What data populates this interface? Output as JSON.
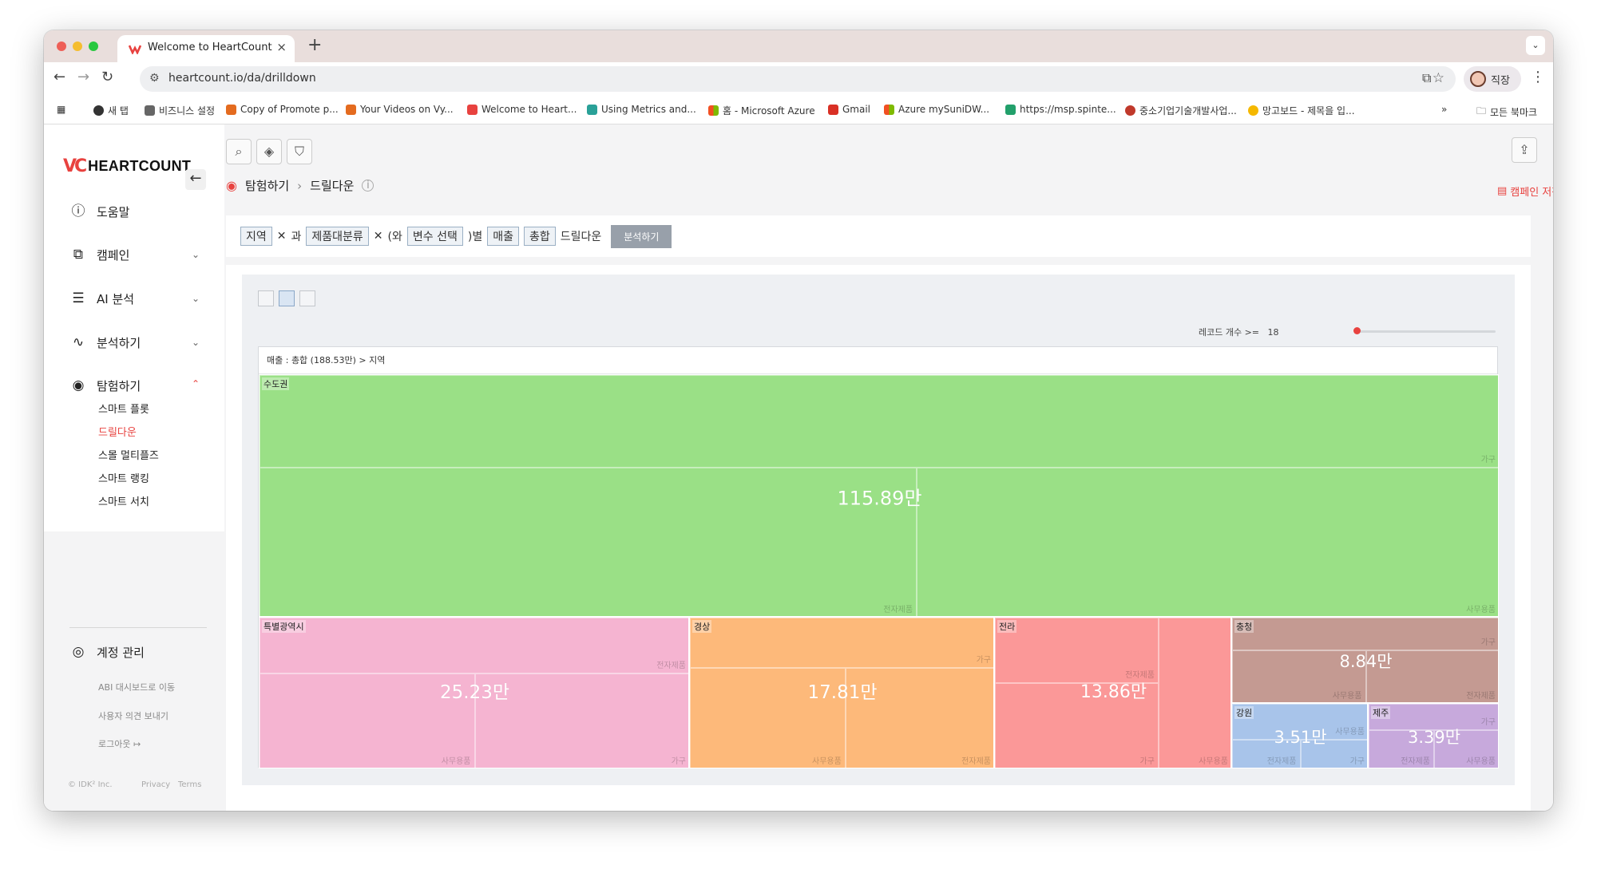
{
  "browser": {
    "tab_title": "Welcome to HeartCount",
    "url": "heartcount.io/da/drilldown",
    "profile_name": "직장",
    "bookmarks": [
      {
        "label": "새 탭",
        "color": "#333333"
      },
      {
        "label": "비즈니스 설정",
        "color": "#555555"
      },
      {
        "label": "Copy of Promote p...",
        "color": "#e46b1f"
      },
      {
        "label": "Your Videos on Vy...",
        "color": "#e46b1f"
      },
      {
        "label": "Welcome to Heart...",
        "color": "#e8423f"
      },
      {
        "label": "Using Metrics and...",
        "color": "#2aa198"
      },
      {
        "label": "홈 - Microsoft Azure",
        "color": "#f25022"
      },
      {
        "label": "Gmail",
        "color": "#d93025"
      },
      {
        "label": "Azure mySuniDW...",
        "color": "#f25022"
      },
      {
        "label": "https://msp.spinte...",
        "color": "#22a06b"
      },
      {
        "label": "중소기업기술개발사업...",
        "color": "#c0392b"
      },
      {
        "label": "망고보드 - 제목을 입...",
        "color": "#f5b800"
      }
    ],
    "more_bookmarks": "»",
    "all_bookmarks": "모든 북마크"
  },
  "sidebar": {
    "logo_text": "HEARTCOUNT",
    "items": [
      {
        "label": "도움말",
        "icon": "info-icon"
      },
      {
        "label": "캠페인",
        "icon": "campaign-icon"
      },
      {
        "label": "AI 분석",
        "icon": "chat-icon"
      },
      {
        "label": "분석하기",
        "icon": "analytics-icon"
      },
      {
        "label": "탐험하기",
        "icon": "eye-icon"
      }
    ],
    "sub_items": [
      "스마트 플롯",
      "드릴다운",
      "스몰 멀티플즈",
      "스마트 랭킹",
      "스마트 서치"
    ],
    "account": "계정 관리",
    "links": [
      "ABI 대시보드로 이동",
      "사용자 의견 보내기",
      "로그아웃"
    ],
    "footer": {
      "copyright": "© IDK² Inc.",
      "privacy": "Privacy",
      "terms": "Terms"
    }
  },
  "main": {
    "breadcrumb": {
      "parent": "탐험하기",
      "current": "드릴다운"
    },
    "save_campaign": "캠페인 저장",
    "query": {
      "chip1": "지역",
      "conj1": "과",
      "chip2": "제품대분류",
      "open_paren": "(와",
      "chip3": "변수 선택",
      "by": ")별",
      "chip4": "매출",
      "chip5": "총합",
      "suffix": "드릴다운",
      "analyze_button": "분석하기"
    },
    "record_count_label": "레코드 개수 >=",
    "record_count_value": "18",
    "record_count_slider_fraction": 0.0,
    "treemap_header": "매출 : 총합 (188.53만) > 지역"
  },
  "chart_data": {
    "type": "treemap",
    "measure": "매출 : 총합",
    "total": "188.53만",
    "regions": [
      {
        "name": "수도권",
        "value": 115.89,
        "label": "115.89만",
        "color": "#9ae086",
        "children": [
          {
            "name": "가구"
          },
          {
            "name": "전자제품"
          },
          {
            "name": "사무용품"
          }
        ]
      },
      {
        "name": "특별광역시",
        "value": 25.23,
        "label": "25.23만",
        "color": "#f5b4d1",
        "children": [
          {
            "name": "전자제품"
          },
          {
            "name": "사무용품"
          },
          {
            "name": "가구"
          }
        ]
      },
      {
        "name": "경상",
        "value": 17.81,
        "label": "17.81만",
        "color": "#fdb97a",
        "children": [
          {
            "name": "가구"
          },
          {
            "name": "사무용품"
          },
          {
            "name": "전자제품"
          }
        ]
      },
      {
        "name": "전라",
        "value": 13.86,
        "label": "13.86만",
        "color": "#fb9898",
        "children": [
          {
            "name": "전자제품"
          },
          {
            "name": "가구"
          },
          {
            "name": "사무용품"
          }
        ]
      },
      {
        "name": "충청",
        "value": 8.84,
        "label": "8.84만",
        "color": "#c49a92",
        "children": [
          {
            "name": "가구"
          },
          {
            "name": "사무용품"
          },
          {
            "name": "전자제품"
          }
        ]
      },
      {
        "name": "강원",
        "value": 3.51,
        "label": "3.51만",
        "color": "#a8c4ea",
        "children": [
          {
            "name": "사무용품"
          },
          {
            "name": "전자제품"
          },
          {
            "name": "가구"
          }
        ]
      },
      {
        "name": "제주",
        "value": 3.39,
        "label": "3.39만",
        "color": "#c7a9dc",
        "children": [
          {
            "name": "가구"
          },
          {
            "name": "전자제품"
          },
          {
            "name": "사무용품"
          }
        ]
      }
    ]
  }
}
